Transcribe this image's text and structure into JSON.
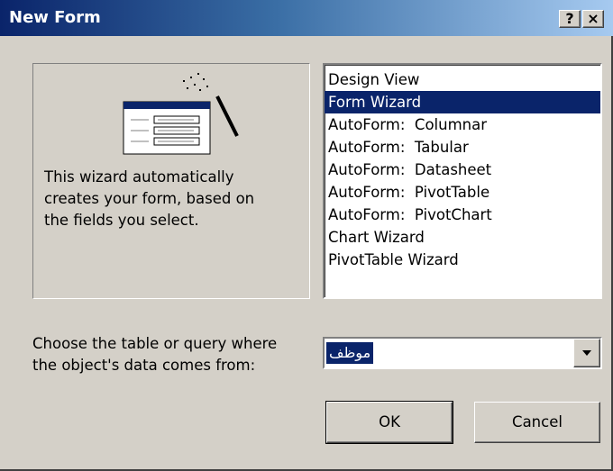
{
  "window": {
    "title": "New Form",
    "help_label": "?",
    "close_label": "×"
  },
  "preview": {
    "icon": "form-wizard-icon",
    "description": "This wizard automatically\ncreates your form, based on\nthe fields you select."
  },
  "list": {
    "items": [
      {
        "label": "Design View"
      },
      {
        "label": "Form Wizard"
      },
      {
        "label": "AutoForm:  Columnar"
      },
      {
        "label": "AutoForm:  Tabular"
      },
      {
        "label": "AutoForm:  Datasheet"
      },
      {
        "label": "AutoForm:  PivotTable"
      },
      {
        "label": "AutoForm:  PivotChart"
      },
      {
        "label": "Chart Wizard"
      },
      {
        "label": "PivotTable Wizard"
      }
    ],
    "selected_index": 1
  },
  "source": {
    "label": "Choose the table or query where\nthe object's data comes from:",
    "value": "موظف"
  },
  "buttons": {
    "ok": "OK",
    "cancel": "Cancel"
  },
  "colors": {
    "selection": "#0a246a",
    "face": "#d4d0c8"
  }
}
